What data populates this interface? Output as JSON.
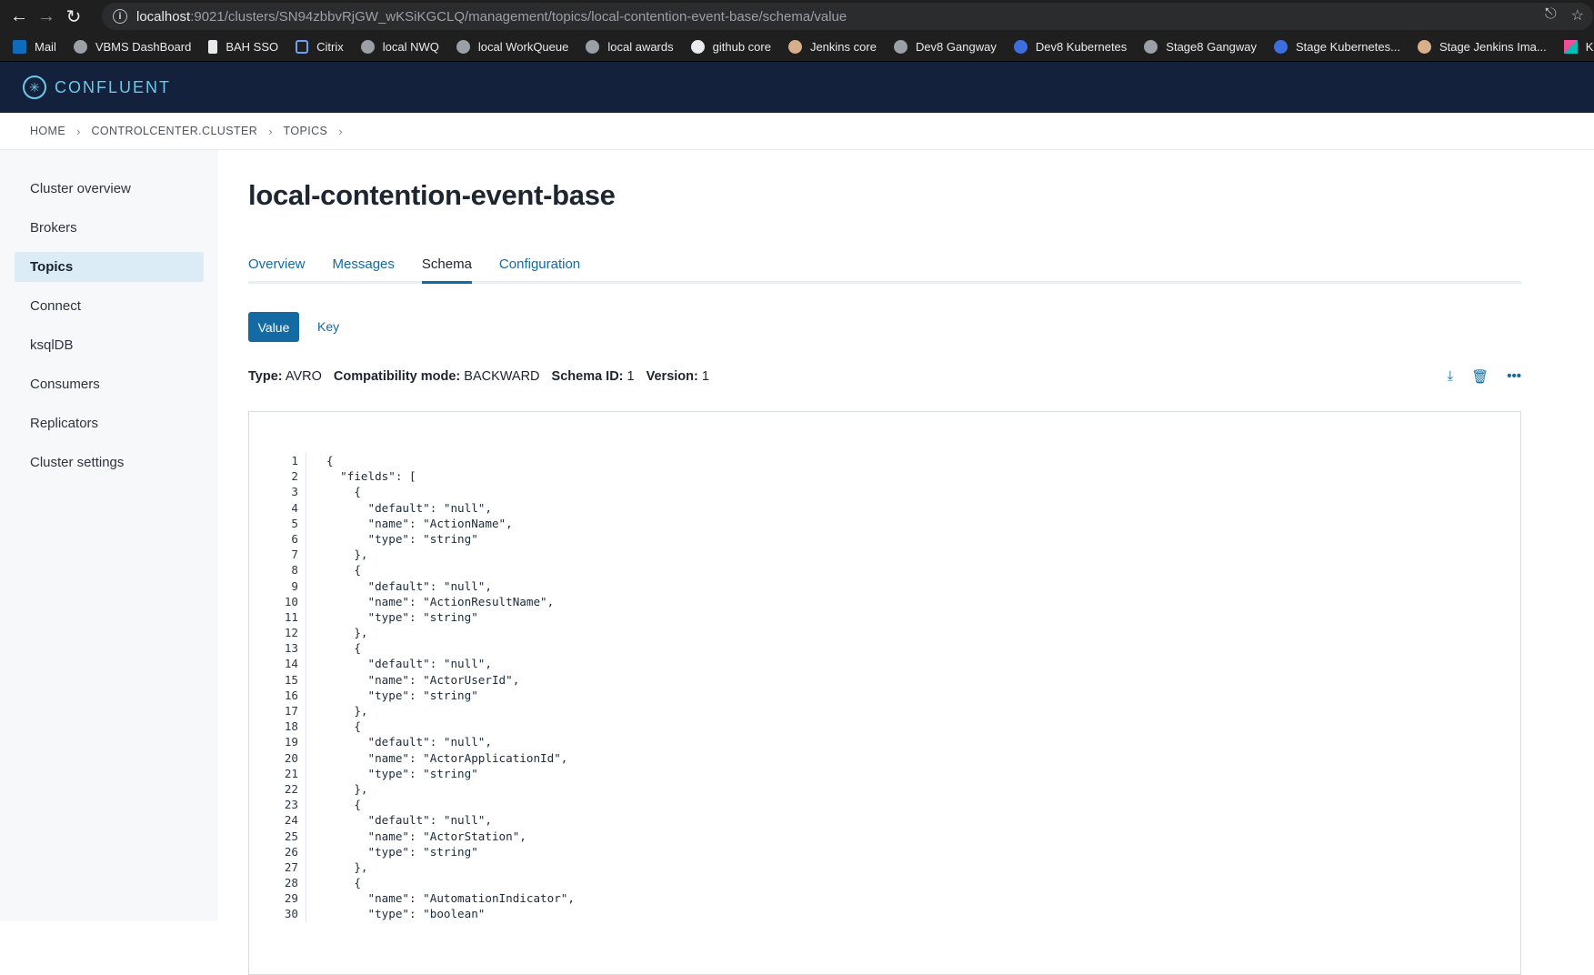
{
  "browser": {
    "url_host": "localhost",
    "url_rest": ":9021/clusters/SN94zbbvRjGW_wKSiKGCLQ/management/topics/local-contention-event-base/schema/value",
    "bookmarks": [
      "Mail",
      "VBMS DashBoard",
      "BAH SSO",
      "Citrix",
      "local NWQ",
      "local WorkQueue",
      "local awards",
      "github core",
      "Jenkins core",
      "Dev8 Gangway",
      "Dev8 Kubernetes",
      "Stage8 Gangway",
      "Stage Kubernetes...",
      "Stage Jenkins Ima...",
      "Kibana"
    ]
  },
  "app": {
    "logo": "CONFLUENT"
  },
  "breadcrumb": [
    "HOME",
    "CONTROLCENTER.CLUSTER",
    "TOPICS"
  ],
  "sidebar": [
    "Cluster overview",
    "Brokers",
    "Topics",
    "Connect",
    "ksqlDB",
    "Consumers",
    "Replicators",
    "Cluster settings"
  ],
  "topic": {
    "title": "local-contention-event-base",
    "tabs": [
      "Overview",
      "Messages",
      "Schema",
      "Configuration"
    ],
    "subject_buttons": {
      "value": "Value",
      "key": "Key"
    },
    "meta": {
      "type_label": "Type:",
      "type_value": "AVRO",
      "compat_label": "Compatibility mode:",
      "compat_value": "BACKWARD",
      "id_label": "Schema ID:",
      "id_value": "1",
      "version_label": "Version:",
      "version_value": "1"
    }
  },
  "code": [
    "{",
    "  \"fields\": [",
    "    {",
    "      \"default\": \"null\",",
    "      \"name\": \"ActionName\",",
    "      \"type\": \"string\"",
    "    },",
    "    {",
    "      \"default\": \"null\",",
    "      \"name\": \"ActionResultName\",",
    "      \"type\": \"string\"",
    "    },",
    "    {",
    "      \"default\": \"null\",",
    "      \"name\": \"ActorUserId\",",
    "      \"type\": \"string\"",
    "    },",
    "    {",
    "      \"default\": \"null\",",
    "      \"name\": \"ActorApplicationId\",",
    "      \"type\": \"string\"",
    "    },",
    "    {",
    "      \"default\": \"null\",",
    "      \"name\": \"ActorStation\",",
    "      \"type\": \"string\"",
    "    },",
    "    {",
    "      \"name\": \"AutomationIndicator\",",
    "      \"type\": \"boolean\""
  ]
}
